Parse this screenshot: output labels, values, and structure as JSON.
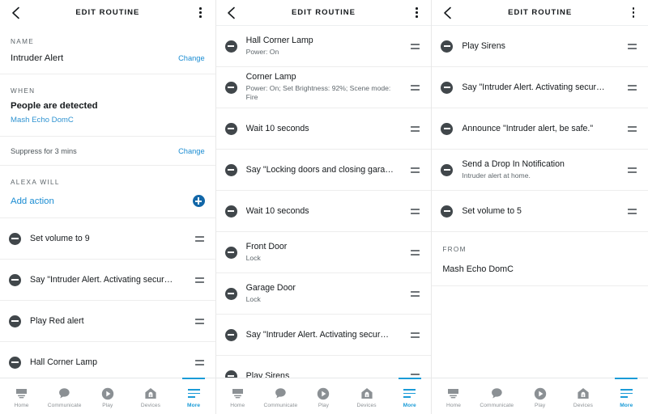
{
  "header": {
    "title": "EDIT ROUTINE",
    "back_icon": "chevron-left-icon",
    "menu_icon": "kebab-menu-icon"
  },
  "panel1": {
    "name_label": "NAME",
    "name_value": "Intruder Alert",
    "name_change": "Change",
    "when_label": "WHEN",
    "when_title": "People are detected",
    "when_device": "Mash Echo DomC",
    "suppress_value": "Suppress for 3 mins",
    "suppress_change": "Change",
    "alexa_will_label": "ALEXA WILL",
    "add_action_label": "Add action",
    "add_action_icon": "plus-circle-icon",
    "actions": [
      {
        "title": "Set volume to 9",
        "sub": ""
      },
      {
        "title": "Say \"Intruder Alert. Activating secur…",
        "sub": ""
      },
      {
        "title": "Play Red alert",
        "sub": ""
      },
      {
        "title": "Hall Corner Lamp",
        "sub": ""
      }
    ]
  },
  "panel2": {
    "actions": [
      {
        "title": "Hall Corner Lamp",
        "sub": "Power: On"
      },
      {
        "title": "Corner Lamp",
        "sub": "Power: On; Set Brightness: 92%; Scene mode: Fire"
      },
      {
        "title": "Wait 10 seconds",
        "sub": ""
      },
      {
        "title": "Say \"Locking doors and closing gara…",
        "sub": ""
      },
      {
        "title": "Wait 10 seconds",
        "sub": ""
      },
      {
        "title": "Front Door",
        "sub": "Lock"
      },
      {
        "title": "Garage Door",
        "sub": "Lock"
      },
      {
        "title": "Say \"Intruder Alert. Activating secur…",
        "sub": ""
      },
      {
        "title": "Play Sirens",
        "sub": ""
      }
    ]
  },
  "panel3": {
    "actions": [
      {
        "title": "Play Sirens",
        "sub": ""
      },
      {
        "title": "Say \"Intruder Alert. Activating secur…",
        "sub": ""
      },
      {
        "title": "Announce \"Intruder alert, be safe.\"",
        "sub": ""
      },
      {
        "title": "Send a Drop In Notification",
        "sub": "Intruder alert at home."
      },
      {
        "title": "Set volume to 5",
        "sub": ""
      }
    ],
    "from_label": "FROM",
    "from_value": "Mash Echo DomC"
  },
  "tabbar": {
    "items": [
      {
        "label": "Home",
        "icon": "echo-device-icon",
        "active": false
      },
      {
        "label": "Communicate",
        "icon": "speech-bubble-icon",
        "active": false
      },
      {
        "label": "Play",
        "icon": "play-circle-icon",
        "active": false
      },
      {
        "label": "Devices",
        "icon": "home-devices-icon",
        "active": false
      },
      {
        "label": "More",
        "icon": "more-lines-icon",
        "active": true
      }
    ]
  },
  "colors": {
    "accent_blue": "#1a9bd7",
    "link_blue": "#1a8cd2",
    "plus_blue": "#1267a8",
    "text_dark": "#15191c",
    "text_muted": "#5f676c"
  }
}
